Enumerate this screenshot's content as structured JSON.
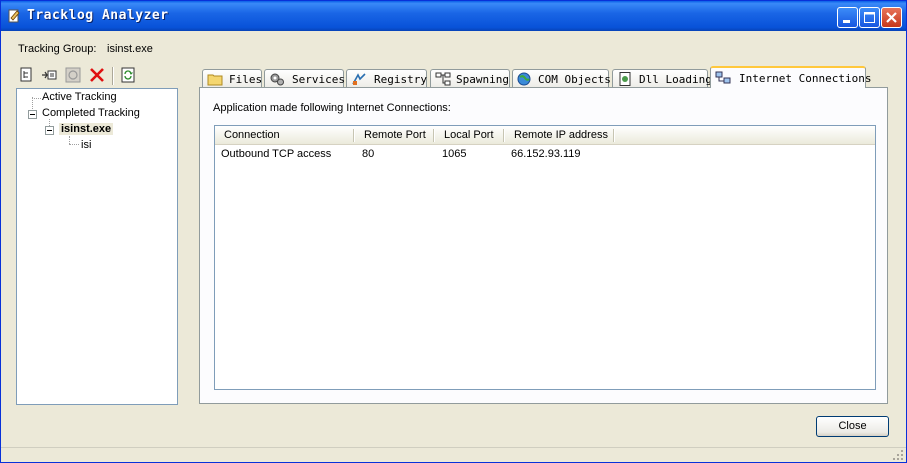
{
  "window": {
    "title": "Tracklog Analyzer"
  },
  "tracking_group": {
    "label": "Tracking Group:",
    "value": "isinst.exe"
  },
  "toolbar": {
    "tools": [
      "new-tree-icon",
      "import-icon",
      "stop-icon",
      "delete-icon",
      "refresh-icon"
    ]
  },
  "tree": {
    "active": "Active Tracking",
    "completed": "Completed Tracking",
    "process": "isinst.exe",
    "child": "isi"
  },
  "tabs": [
    {
      "label": "Files",
      "icon": "folder-icon"
    },
    {
      "label": "Services",
      "icon": "gears-icon"
    },
    {
      "label": "Registry",
      "icon": "registry-icon"
    },
    {
      "label": "Spawning",
      "icon": "hierarchy-icon"
    },
    {
      "label": "COM Objects",
      "icon": "globe-icon"
    },
    {
      "label": "Dll Loading",
      "icon": "dll-icon"
    },
    {
      "label": "Internet Connections",
      "icon": "network-icon",
      "active": true
    }
  ],
  "connections": {
    "caption": "Application made following Internet Connections:",
    "columns": [
      "Connection",
      "Remote Port",
      "Local Port",
      "Remote IP address"
    ],
    "rows": [
      [
        "Outbound TCP access",
        "80",
        "1065",
        "66.152.93.119"
      ]
    ]
  },
  "buttons": {
    "close": "Close"
  },
  "colors": {
    "titlebar": "#0A5FE8",
    "face": "#ECE9D8",
    "tab_accent": "#FFC83C"
  }
}
